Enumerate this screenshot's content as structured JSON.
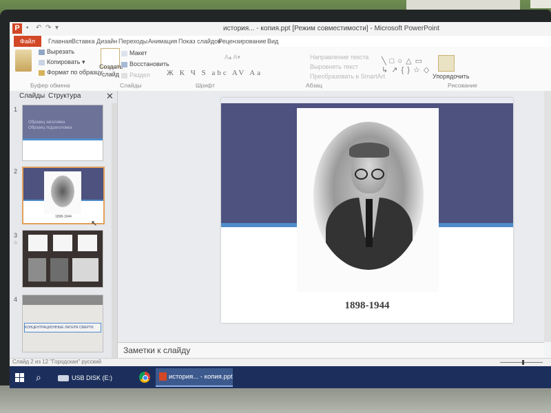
{
  "window": {
    "title": "история... - копия.ppt [Режим совместимости] - Microsoft PowerPoint",
    "app_icon": "powerpoint-icon",
    "qat": [
      "save-icon",
      "undo-icon",
      "redo-icon"
    ]
  },
  "ribbon_tabs": [
    "Файл",
    "Главная",
    "Вставка",
    "Дизайн",
    "Переходы",
    "Анимация",
    "Показ слайдов",
    "Рецензирование",
    "Вид"
  ],
  "clipboard": {
    "cut": "Вырезать",
    "copy": "Копировать",
    "copy_arrow": "▾",
    "format_painter": "Формат по образцу",
    "label": "Буфер обмена"
  },
  "slides_group": {
    "new_slide_1": "Создать",
    "new_slide_2": "слайд",
    "layout": "Макет",
    "reset": "Восстановить",
    "section": "Раздел",
    "label": "Слайды"
  },
  "font_group": {
    "format_buttons": "Ж К Ч S abc AV Aa",
    "label": "Шрифт"
  },
  "paragraph_group": {
    "text_direction": "Направление текста",
    "align_text": "Выровнять текст",
    "smartart": "Преобразовать в SmartArt",
    "label": "Абзац"
  },
  "drawing_group": {
    "arrange": "Упорядочить",
    "label": "Рисование"
  },
  "pane": {
    "tab_slides": "Слайды",
    "tab_outline": "Структура",
    "close": "✕",
    "thumbs": [
      {
        "num": "1",
        "line1": "Образец заголовка",
        "line2": "Образец подзаголовка"
      },
      {
        "num": "2",
        "years": "1898-1944"
      },
      {
        "num": "3"
      },
      {
        "num": "4",
        "banner": "КОНЦЕНТРАЦИОННЫЕ ЛАГЕРЯ СМЕРТИ"
      }
    ]
  },
  "slide": {
    "years": "1898-1944"
  },
  "notes": {
    "placeholder": "Заметки к слайду"
  },
  "status": {
    "text": "Слайд 2 из 12  \"Городская\"  русский"
  },
  "taskbar": {
    "usb": "USB DISK (E:)",
    "ppt": "история... - копия.ppt..."
  }
}
